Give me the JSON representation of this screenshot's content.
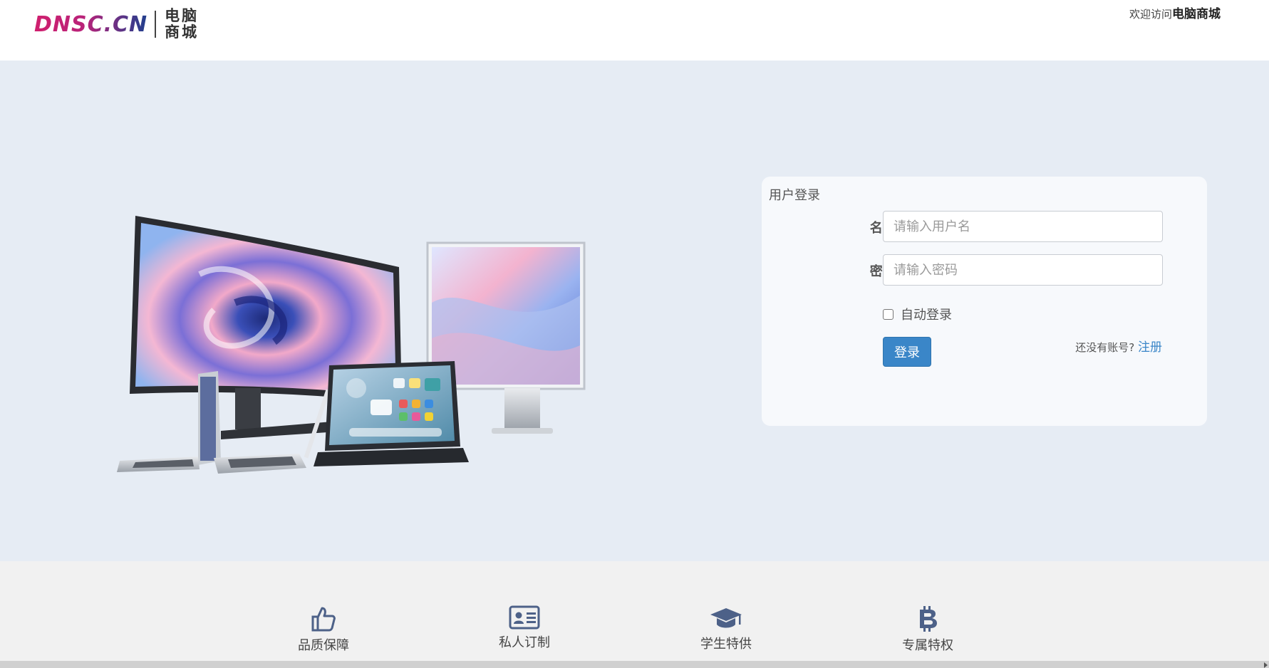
{
  "header": {
    "logo_en": "DNSC.CN",
    "logo_cn_line1": "电脑",
    "logo_cn_line2": "商城",
    "welcome_prefix": "欢迎访问",
    "welcome_site": "电脑商城"
  },
  "login": {
    "title": "用户登录",
    "username_label": "名字:",
    "username_placeholder": "请输入用户名",
    "password_label": "密码:",
    "password_placeholder": "请输入密码",
    "remember_label": "自动登录",
    "remember_checked": false,
    "submit_label": "登录",
    "no_account_text": "还没有账号?",
    "register_label": "注册"
  },
  "features": [
    {
      "icon": "thumbs-up-icon",
      "label": "品质保障"
    },
    {
      "icon": "id-card-icon",
      "label": "私人订制"
    },
    {
      "icon": "graduation-cap-icon",
      "label": "学生特供"
    },
    {
      "icon": "bitcoin-icon",
      "label": "专属特权"
    }
  ],
  "colors": {
    "hero_bg": "#e6ecf4",
    "accent": "#3a86c8",
    "feature_icon": "#4d6188",
    "logo_magenta": "#d01f6e",
    "logo_navy": "#1f3f8e"
  }
}
